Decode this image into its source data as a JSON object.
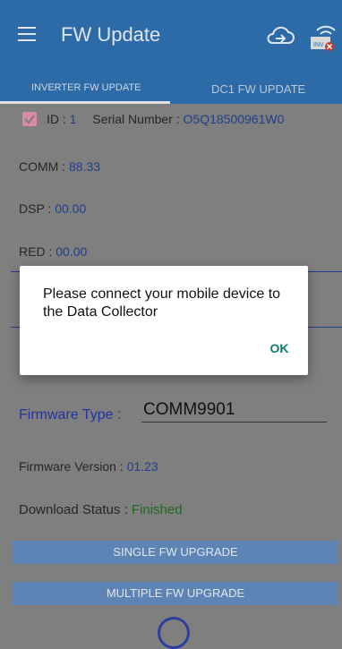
{
  "header": {
    "title": "FW Update"
  },
  "tabs": [
    {
      "label": "INVERTER FW UPDATE"
    },
    {
      "label": "DC1 FW UPDATE"
    }
  ],
  "inverter": {
    "id_label": "ID :",
    "id_value": "1",
    "serial_label": "Serial Number :",
    "serial_value": "O5Q18500961W0",
    "comm_label": "COMM :",
    "comm_value": "88.33",
    "dsp_label": "DSP :",
    "dsp_value": "00.00",
    "red_label": "RED :",
    "red_value": "00.00",
    "checked": true
  },
  "firmware": {
    "type_label": "Firmware Type :",
    "type_value": "COMM9901",
    "version_label": "Firmware Version :",
    "version_value": "01.23",
    "status_label": "Download Status :",
    "status_value": "Finished"
  },
  "buttons": {
    "single": "SINGLE FW UPGRADE",
    "multiple": "MULTIPLE FW UPGRADE"
  },
  "dialog": {
    "message": "Please connect your mobile device to the Data Collector",
    "ok": "OK"
  },
  "colors": {
    "accent": "#2c6aa8",
    "dialog_ok": "#0a7d6d",
    "status_green": "#1f6a1f"
  },
  "icons": [
    "menu-icon",
    "cloud-upload-icon",
    "inverter-disconnected-icon"
  ]
}
